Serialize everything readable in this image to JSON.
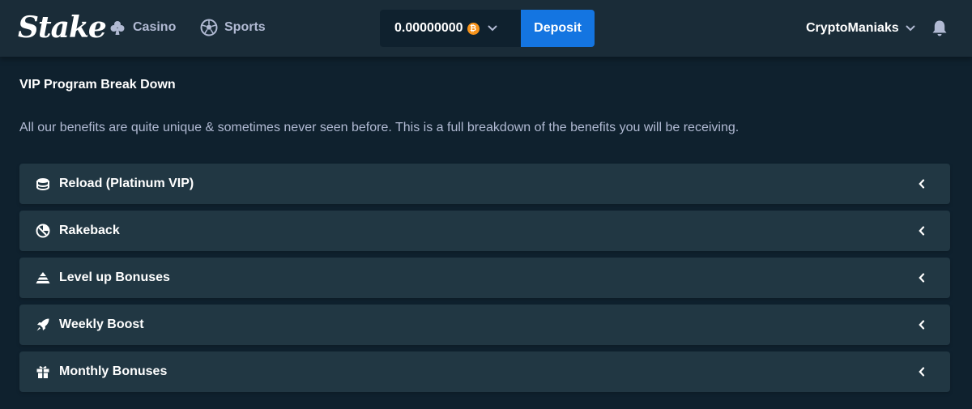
{
  "header": {
    "logo": "Stake",
    "nav": [
      {
        "label": "Casino",
        "icon": "club-icon"
      },
      {
        "label": "Sports",
        "icon": "soccer-ball-icon"
      }
    ],
    "wallet": {
      "balance": "0.00000000",
      "currency_icon": "bitcoin-icon",
      "currency_glyph": "₿"
    },
    "deposit_label": "Deposit",
    "username": "CryptoManiaks",
    "bell_icon": "bell-icon"
  },
  "main": {
    "title": "VIP Program Break Down",
    "description": "All our benefits are quite unique & sometimes never seen before. This is a full breakdown of the benefits you will be receiving.",
    "benefits": [
      {
        "label": "Reload (Platinum VIP)",
        "icon": "reload-coins-icon"
      },
      {
        "label": "Rakeback",
        "icon": "rakeback-icon"
      },
      {
        "label": "Level up Bonuses",
        "icon": "level-up-icon"
      },
      {
        "label": "Weekly Boost",
        "icon": "rocket-icon"
      },
      {
        "label": "Monthly Bonuses",
        "icon": "gift-icon"
      }
    ]
  },
  "colors": {
    "background": "#0f212e",
    "header": "#1a2c38",
    "card": "#213743",
    "accent_blue": "#1475e1",
    "muted_text": "#b1bad3",
    "bitcoin": "#f7931a"
  }
}
